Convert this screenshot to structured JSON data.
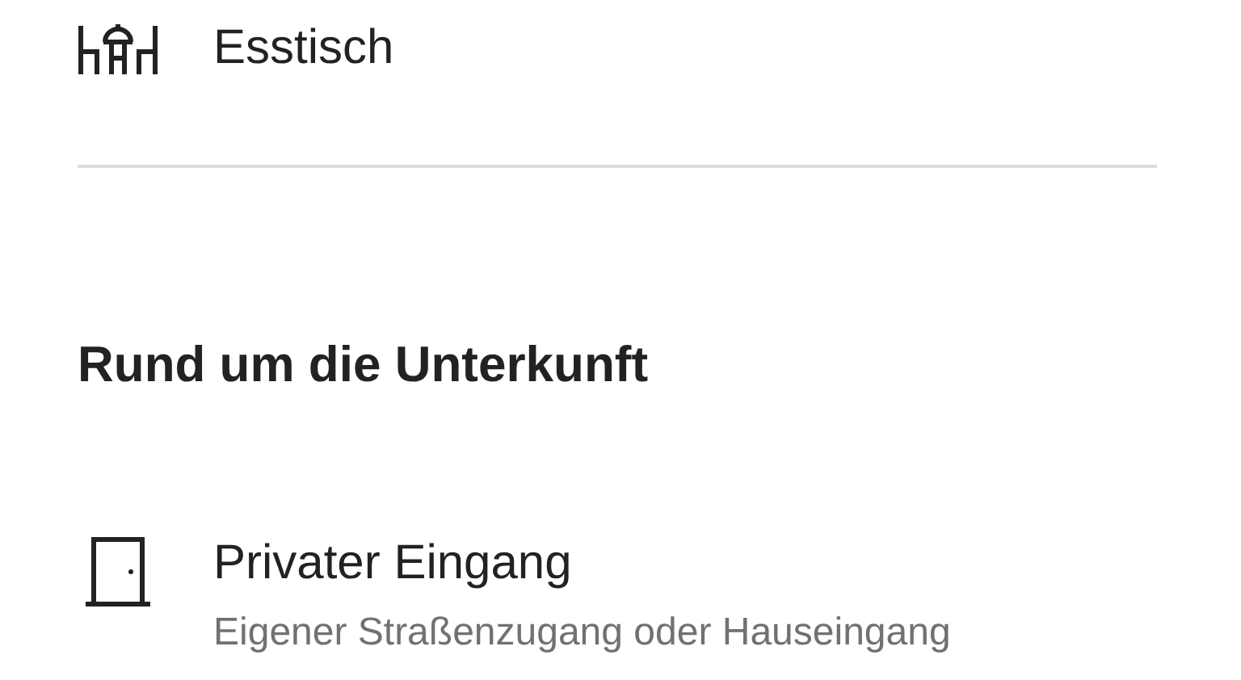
{
  "amenities": [
    {
      "kind": "dining-table",
      "label": "Esstisch"
    }
  ],
  "section": {
    "title": "Rund um die Unterkunft",
    "items": [
      {
        "kind": "door",
        "label": "Privater Eingang",
        "description": "Eigener Straßenzugang oder Hauseingang"
      }
    ]
  }
}
